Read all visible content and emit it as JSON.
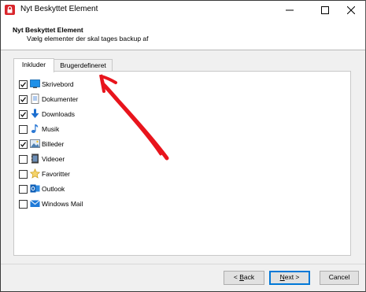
{
  "window": {
    "title": "Nyt Beskyttet Element"
  },
  "header": {
    "title": "Nyt Beskyttet Element",
    "subtitle": "Vælg elementer der skal tages backup af"
  },
  "tabs": [
    {
      "label": "Inkluder",
      "selected": true
    },
    {
      "label": "Brugerdefineret",
      "selected": false
    }
  ],
  "items": [
    {
      "label": "Skrivebord",
      "checked": true,
      "icon": "desktop-icon"
    },
    {
      "label": "Dokumenter",
      "checked": true,
      "icon": "documents-icon"
    },
    {
      "label": "Downloads",
      "checked": true,
      "icon": "downloads-icon"
    },
    {
      "label": "Musik",
      "checked": false,
      "icon": "music-icon"
    },
    {
      "label": "Billeder",
      "checked": true,
      "icon": "pictures-icon"
    },
    {
      "label": "Videoer",
      "checked": false,
      "icon": "videos-icon"
    },
    {
      "label": "Favoritter",
      "checked": false,
      "icon": "favorites-star-icon"
    },
    {
      "label": "Outlook",
      "checked": false,
      "icon": "outlook-icon"
    },
    {
      "label": "Windows Mail",
      "checked": false,
      "icon": "windows-mail-icon"
    }
  ],
  "buttons": {
    "back_prefix": "< ",
    "back_underlined": "B",
    "back_rest": "ack",
    "next_underlined": "N",
    "next_rest": "ext >",
    "cancel": "Cancel"
  },
  "colors": {
    "annotation_arrow": "#e8141c",
    "app_icon": "#d9262c",
    "focus_border": "#0078d7"
  }
}
